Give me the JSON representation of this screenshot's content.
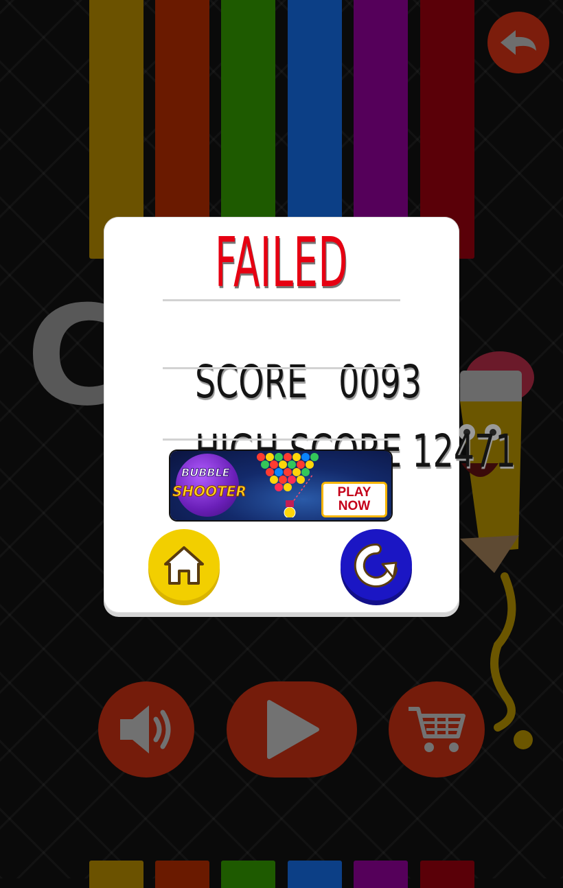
{
  "dialog": {
    "title": "FAILED",
    "score_label": "SCORE",
    "score_value": "0093",
    "high_score_label": "HIGH SCORE",
    "high_score_value": "12471"
  },
  "ad": {
    "game_name_line1": "BUBBLE",
    "game_name_line2": "SHOOTER",
    "cta_line1": "PLAY",
    "cta_line2": "NOW"
  },
  "background": {
    "letter": "C"
  },
  "colors": {
    "title_red": "#e60012",
    "home_button": "#f2cf00",
    "replay_button": "#1b16c4",
    "bar_colors": [
      "#6b5200",
      "#6a1a00",
      "#1e5a00",
      "#0c3f86",
      "#55005a",
      "#5a0008"
    ]
  },
  "icons": {
    "back": "arrow-left-icon",
    "home": "home-icon",
    "replay": "replay-icon",
    "sound": "speaker-icon",
    "play": "play-icon",
    "cart": "cart-icon"
  }
}
